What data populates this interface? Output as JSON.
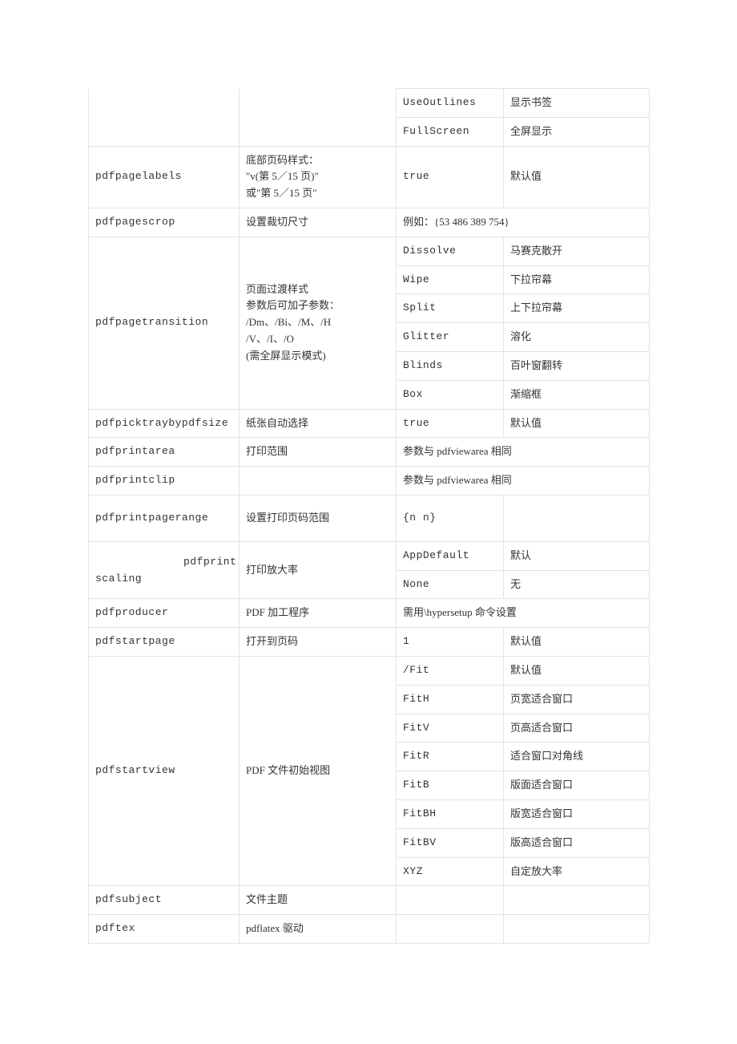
{
  "r1": {
    "c3": "UseOutlines",
    "c4": "显示书签"
  },
  "r2": {
    "c3": "FullScreen",
    "c4": "全屏显示"
  },
  "r3": {
    "c1": "pdfpagelabels",
    "c2": "底部页码样式：\n\"v(第 5／15 页)\"\n或\"第 5／15 页\"",
    "c3": "true",
    "c4": "默认值"
  },
  "r4": {
    "c1": "pdfpagescrop",
    "c2": "设置裁切尺寸",
    "c34": "例如：{53 486 389 754}"
  },
  "r5": {
    "c1": "pdfpagetransition",
    "c2": "页面过渡样式\n参数后可加子参数：\n/Dm、/Bi、/M、/H\n/V、/I、/O\n(需全屏显示模式)",
    "c3": "Dissolve",
    "c4": "马赛克散开"
  },
  "r6": {
    "c3": "Wipe",
    "c4": "下拉帘幕"
  },
  "r7": {
    "c3": "Split",
    "c4": "上下拉帘幕"
  },
  "r8": {
    "c3": "Glitter",
    "c4": "溶化"
  },
  "r9": {
    "c3": "Blinds",
    "c4": "百叶窗翻转"
  },
  "r10": {
    "c3": "Box",
    "c4": "渐缩框"
  },
  "r11": {
    "c1": "pdfpicktraybypdfsize",
    "c2": "纸张自动选择",
    "c3": "true",
    "c4": "默认值"
  },
  "r12": {
    "c1": "pdfprintarea",
    "c2": "打印范围",
    "c34": "参数与 pdfviewarea 相同"
  },
  "r13": {
    "c1": "pdfprintclip",
    "c34": "参数与 pdfviewarea 相同"
  },
  "r14": {
    "c1": "pdfprintpagerange",
    "c2": "设置打印页码范围",
    "c3": "{n n}"
  },
  "r15": {
    "c1": "pdfprintscaling",
    "c2": "打印放大率",
    "c3": "AppDefault",
    "c4": "默认"
  },
  "r16": {
    "c3": "None",
    "c4": "无"
  },
  "r17": {
    "c1": "pdfproducer",
    "c2": "PDF 加工程序",
    "c34": "需用\\hypersetup 命令设置"
  },
  "r18": {
    "c1": "pdfstartpage",
    "c2": "打开到页码",
    "c3": "1",
    "c4": "默认值"
  },
  "r19": {
    "c1": "pdfstartview",
    "c2": "PDF 文件初始视图",
    "c3": "/Fit",
    "c4": "默认值"
  },
  "r20": {
    "c3": "FitH",
    "c4": "页宽适合窗口"
  },
  "r21": {
    "c3": "FitV",
    "c4": "页高适合窗口"
  },
  "r22": {
    "c3": "FitR",
    "c4": "适合窗口对角线"
  },
  "r23": {
    "c3": "FitB",
    "c4": "版面适合窗口"
  },
  "r24": {
    "c3": "FitBH",
    "c4": "版宽适合窗口"
  },
  "r25": {
    "c3": "FitBV",
    "c4": "版高适合窗口"
  },
  "r26": {
    "c3": "XYZ",
    "c4": "自定放大率"
  },
  "r27": {
    "c1": "pdfsubject",
    "c2": "文件主题"
  },
  "r28": {
    "c1": "pdftex",
    "c2": "pdflatex 驱动"
  }
}
